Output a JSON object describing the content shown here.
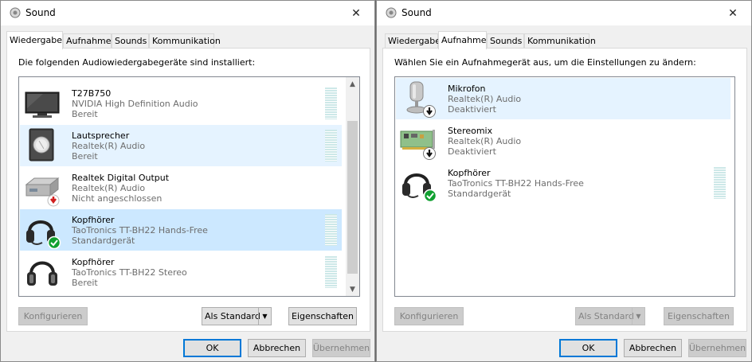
{
  "left": {
    "title": "Sound",
    "close": "✕",
    "tabs": [
      "Wiedergabe",
      "Aufnahme",
      "Sounds",
      "Kommunikation"
    ],
    "instruction": "Die folgenden Audiowiedergabegeräte sind installiert:",
    "devices": [
      {
        "name": "T27B750",
        "driver": "NVIDIA High Definition Audio",
        "status": "Bereit",
        "icon": "monitor-icon"
      },
      {
        "name": "Lautsprecher",
        "driver": "Realtek(R) Audio",
        "status": "Bereit",
        "icon": "speaker-icon"
      },
      {
        "name": "Realtek Digital Output",
        "driver": "Realtek(R) Audio",
        "status": "Nicht angeschlossen",
        "icon": "digital-output-icon"
      },
      {
        "name": "Kopfhörer",
        "driver": "TaoTronics TT-BH22 Hands-Free",
        "status": "Standardgerät",
        "icon": "headset-icon"
      },
      {
        "name": "Kopfhörer",
        "driver": "TaoTronics TT-BH22 Stereo",
        "status": "Bereit",
        "icon": "headphones-icon"
      }
    ],
    "buttons": {
      "configure": "Konfigurieren",
      "set_default": "Als Standard",
      "properties": "Eigenschaften"
    },
    "footer": {
      "ok": "OK",
      "cancel": "Abbrechen",
      "apply": "Übernehmen"
    }
  },
  "right": {
    "title": "Sound",
    "close": "✕",
    "tabs": [
      "Wiedergabe",
      "Aufnahme",
      "Sounds",
      "Kommunikation"
    ],
    "instruction": "Wählen Sie ein Aufnahmegerät aus, um die Einstellungen zu ändern:",
    "devices": [
      {
        "name": "Mikrofon",
        "driver": "Realtek(R) Audio",
        "status": "Deaktiviert",
        "icon": "microphone-icon"
      },
      {
        "name": "Stereomix",
        "driver": "Realtek(R) Audio",
        "status": "Deaktiviert",
        "icon": "sound-card-icon"
      },
      {
        "name": "Kopfhörer",
        "driver": "TaoTronics TT-BH22 Hands-Free",
        "status": "Standardgerät",
        "icon": "headset-icon"
      }
    ],
    "buttons": {
      "configure": "Konfigurieren",
      "set_default": "Als Standard",
      "properties": "Eigenschaften"
    },
    "footer": {
      "ok": "OK",
      "cancel": "Abbrechen",
      "apply": "Übernehmen"
    }
  },
  "colors": {
    "selected_row": "#cce8ff",
    "hover_row": "#e5f3ff",
    "accent": "#0078d7",
    "default_check": "#10a030",
    "disabled_arrow": "#d02020"
  }
}
